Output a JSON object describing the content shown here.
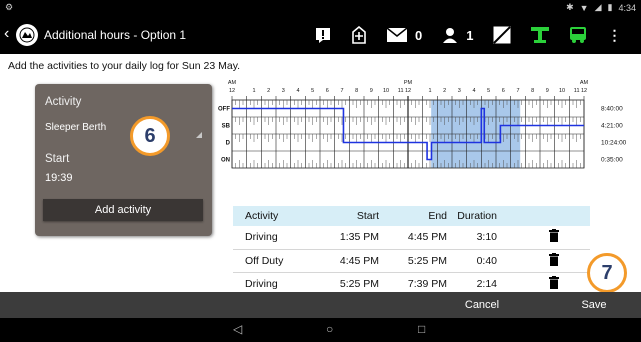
{
  "status": {
    "left_icon": "settings-gear-icon",
    "time": "4:34",
    "icons": [
      "bluetooth-icon",
      "wifi-icon",
      "signal-icon",
      "battery-icon"
    ]
  },
  "header": {
    "title": "Additional hours - Option 1",
    "messages_count": "0",
    "users_count": "1",
    "accent_green": "#2bd13a"
  },
  "instruction": "Add the activities to your daily log for Sun 23 May.",
  "panel": {
    "activity_label": "Activity",
    "activity_value": "Sleeper Berth",
    "start_label": "Start",
    "start_value": "19:39",
    "add_button": "Add activity"
  },
  "callouts": {
    "six": "6",
    "seven": "7"
  },
  "chart_data": {
    "type": "line",
    "am_label": "AM",
    "pm_label": "PM",
    "hour_labels": [
      "12",
      "1",
      "2",
      "3",
      "4",
      "5",
      "6",
      "7",
      "8",
      "9",
      "10",
      "11",
      "12",
      "1",
      "2",
      "3",
      "4",
      "5",
      "6",
      "7",
      "8",
      "9",
      "10",
      "11",
      "12"
    ],
    "status_rows": [
      "OFF",
      "SB",
      "D",
      "ON"
    ],
    "totals": [
      "8:40:00",
      "4:21:00",
      "10:24:00",
      "0:35:00"
    ],
    "segments": [
      {
        "status": "OFF",
        "start_h": 0,
        "end_h": 7.6
      },
      {
        "status": "D",
        "start_h": 7.6,
        "end_h": 13.3
      },
      {
        "status": "ON",
        "start_h": 13.3,
        "end_h": 13.6
      },
      {
        "status": "D",
        "start_h": 13.6,
        "end_h": 17.0
      },
      {
        "status": "OFF",
        "start_h": 17.0,
        "end_h": 17.2
      },
      {
        "status": "D",
        "start_h": 17.2,
        "end_h": 18.3
      },
      {
        "status": "SB",
        "start_h": 18.3,
        "end_h": 24.0
      }
    ],
    "line_color": "#1f33e0",
    "highlight_color": "#a9c8ea",
    "highlight_range_h": [
      13.58,
      19.65
    ]
  },
  "table": {
    "headers": [
      "Activity",
      "Start",
      "End",
      "Duration"
    ],
    "rows": [
      {
        "activity": "Driving",
        "start": "1:35 PM",
        "end": "4:45 PM",
        "duration": "3:10"
      },
      {
        "activity": "Off Duty",
        "start": "4:45 PM",
        "end": "5:25 PM",
        "duration": "0:40"
      },
      {
        "activity": "Driving",
        "start": "5:25 PM",
        "end": "7:39 PM",
        "duration": "2:14"
      }
    ],
    "row_icon": "trash-icon"
  },
  "actions": {
    "cancel": "Cancel",
    "save": "Save"
  },
  "nav": {
    "back": "◁",
    "home": "○",
    "recents": "□"
  }
}
